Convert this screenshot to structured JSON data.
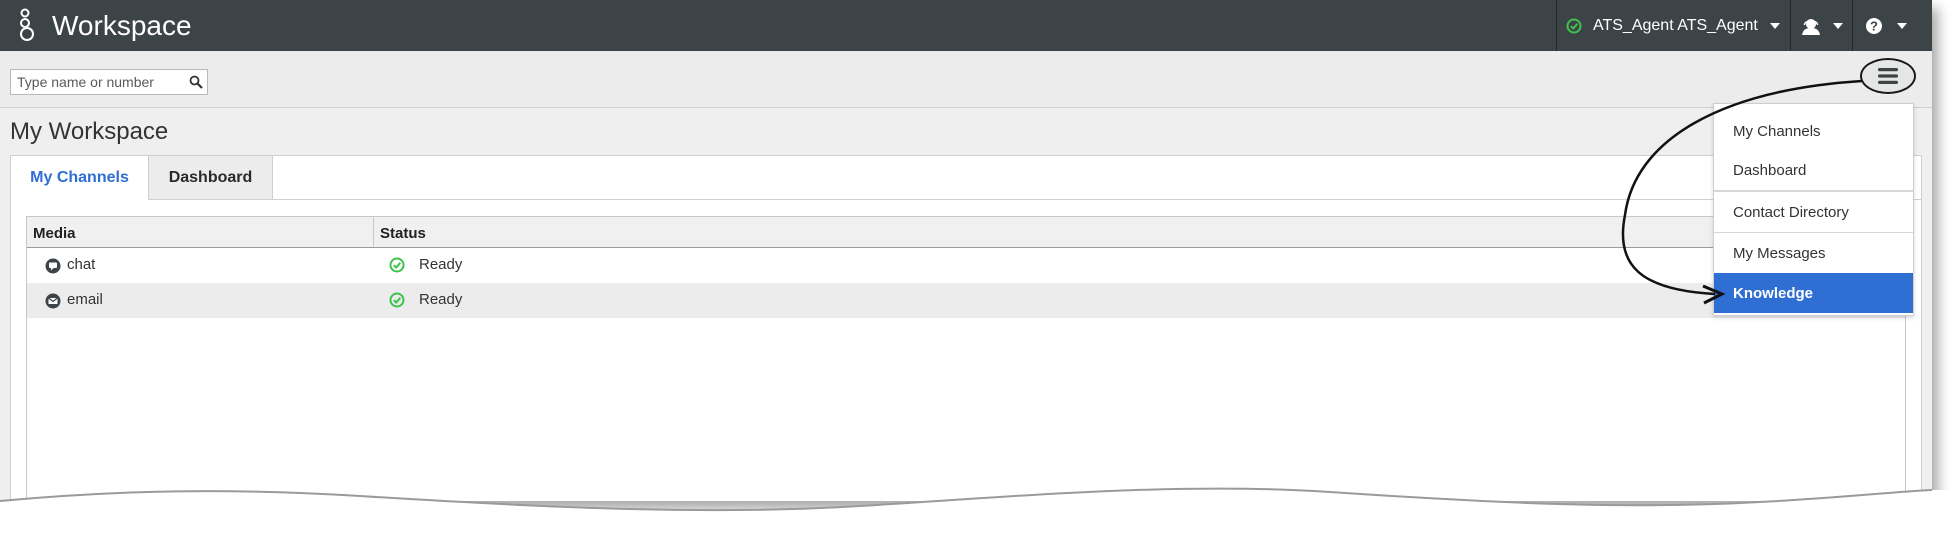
{
  "header": {
    "app_title": "Workspace",
    "agent_name": "ATS_Agent ATS_Agent",
    "status_color": "#3ec34b",
    "icons": {
      "logo": "genesys-logo-icon",
      "agent_status": "check-circle-icon",
      "agent_menu": "agent-headset-icon",
      "help": "help-icon"
    }
  },
  "toolbar": {
    "search_placeholder": "Type name or number",
    "search_icon": "search-icon",
    "menu_icon": "hamburger-menu-icon"
  },
  "main": {
    "page_title": "My Workspace",
    "tabs": [
      {
        "label": "My Channels",
        "active": true
      },
      {
        "label": "Dashboard",
        "active": false
      }
    ],
    "table": {
      "columns": [
        "Media",
        "Status"
      ],
      "rows": [
        {
          "media": "chat",
          "media_icon": "chat-icon",
          "status": "Ready",
          "status_icon": "check-circle-icon"
        },
        {
          "media": "email",
          "media_icon": "email-icon",
          "status": "Ready",
          "status_icon": "check-circle-icon"
        }
      ]
    }
  },
  "dropdown": {
    "items": [
      {
        "label": "My Channels",
        "selected": false
      },
      {
        "label": "Dashboard",
        "selected": false
      },
      {
        "label": "Contact Directory",
        "selected": false
      },
      {
        "label": "My Messages",
        "selected": false
      },
      {
        "label": "Knowledge",
        "selected": true
      }
    ]
  },
  "colors": {
    "header_bg": "#3d4448",
    "accent": "#2f6fd4",
    "ready": "#3ec34b"
  }
}
